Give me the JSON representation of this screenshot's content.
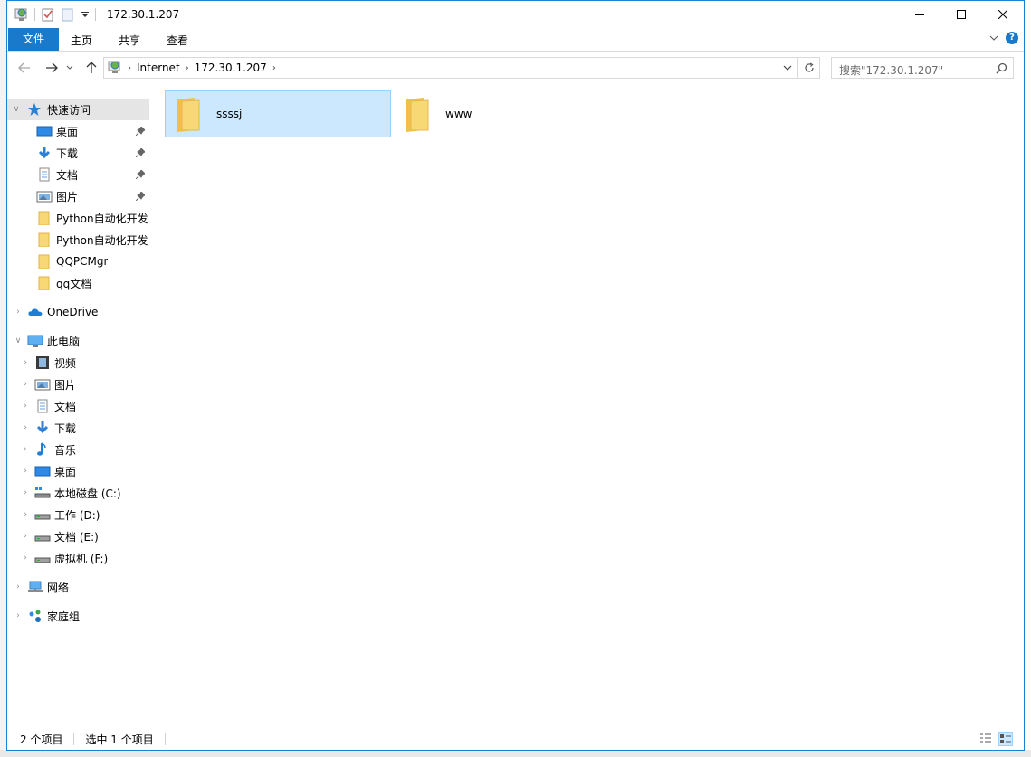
{
  "window": {
    "title": "172.30.1.207"
  },
  "ribbon": {
    "tabs": [
      {
        "label": "文件"
      },
      {
        "label": "主页"
      },
      {
        "label": "共享"
      },
      {
        "label": "查看"
      }
    ],
    "help_label": "?"
  },
  "address": {
    "crumbs": [
      "Internet",
      "172.30.1.207"
    ]
  },
  "search": {
    "placeholder": "搜索\"172.30.1.207\""
  },
  "sidebar": {
    "quick_access": {
      "label": "快速访问"
    },
    "pinned": [
      {
        "label": "桌面",
        "icon": "desktop-icon"
      },
      {
        "label": "下载",
        "icon": "download-icon"
      },
      {
        "label": "文档",
        "icon": "document-icon"
      },
      {
        "label": "图片",
        "icon": "pictures-icon"
      }
    ],
    "recent": [
      {
        "label": "Python自动化开发"
      },
      {
        "label": "Python自动化开发"
      },
      {
        "label": "QQPCMgr"
      },
      {
        "label": "qq文档"
      }
    ],
    "onedrive": {
      "label": "OneDrive"
    },
    "this_pc": {
      "label": "此电脑"
    },
    "pc_items": [
      {
        "label": "视频",
        "icon": "video-icon"
      },
      {
        "label": "图片",
        "icon": "pictures-icon"
      },
      {
        "label": "文档",
        "icon": "document-icon"
      },
      {
        "label": "下载",
        "icon": "download-icon"
      },
      {
        "label": "音乐",
        "icon": "music-icon"
      },
      {
        "label": "桌面",
        "icon": "desktop-icon"
      },
      {
        "label": "本地磁盘 (C:)",
        "icon": "system-drive-icon"
      },
      {
        "label": "工作 (D:)",
        "icon": "drive-icon"
      },
      {
        "label": "文档 (E:)",
        "icon": "drive-icon"
      },
      {
        "label": "虚拟机 (F:)",
        "icon": "drive-icon"
      }
    ],
    "network": {
      "label": "网络"
    },
    "homegroup": {
      "label": "家庭组"
    }
  },
  "content": {
    "items": [
      {
        "name": "ssssj",
        "selected": true
      },
      {
        "name": "www",
        "selected": false
      }
    ]
  },
  "status": {
    "item_count": "2 个项目",
    "selected_count": "选中 1 个项目"
  },
  "colors": {
    "accent": "#1979ca",
    "selection": "#cce8ff",
    "folder": "#f5c84c"
  }
}
